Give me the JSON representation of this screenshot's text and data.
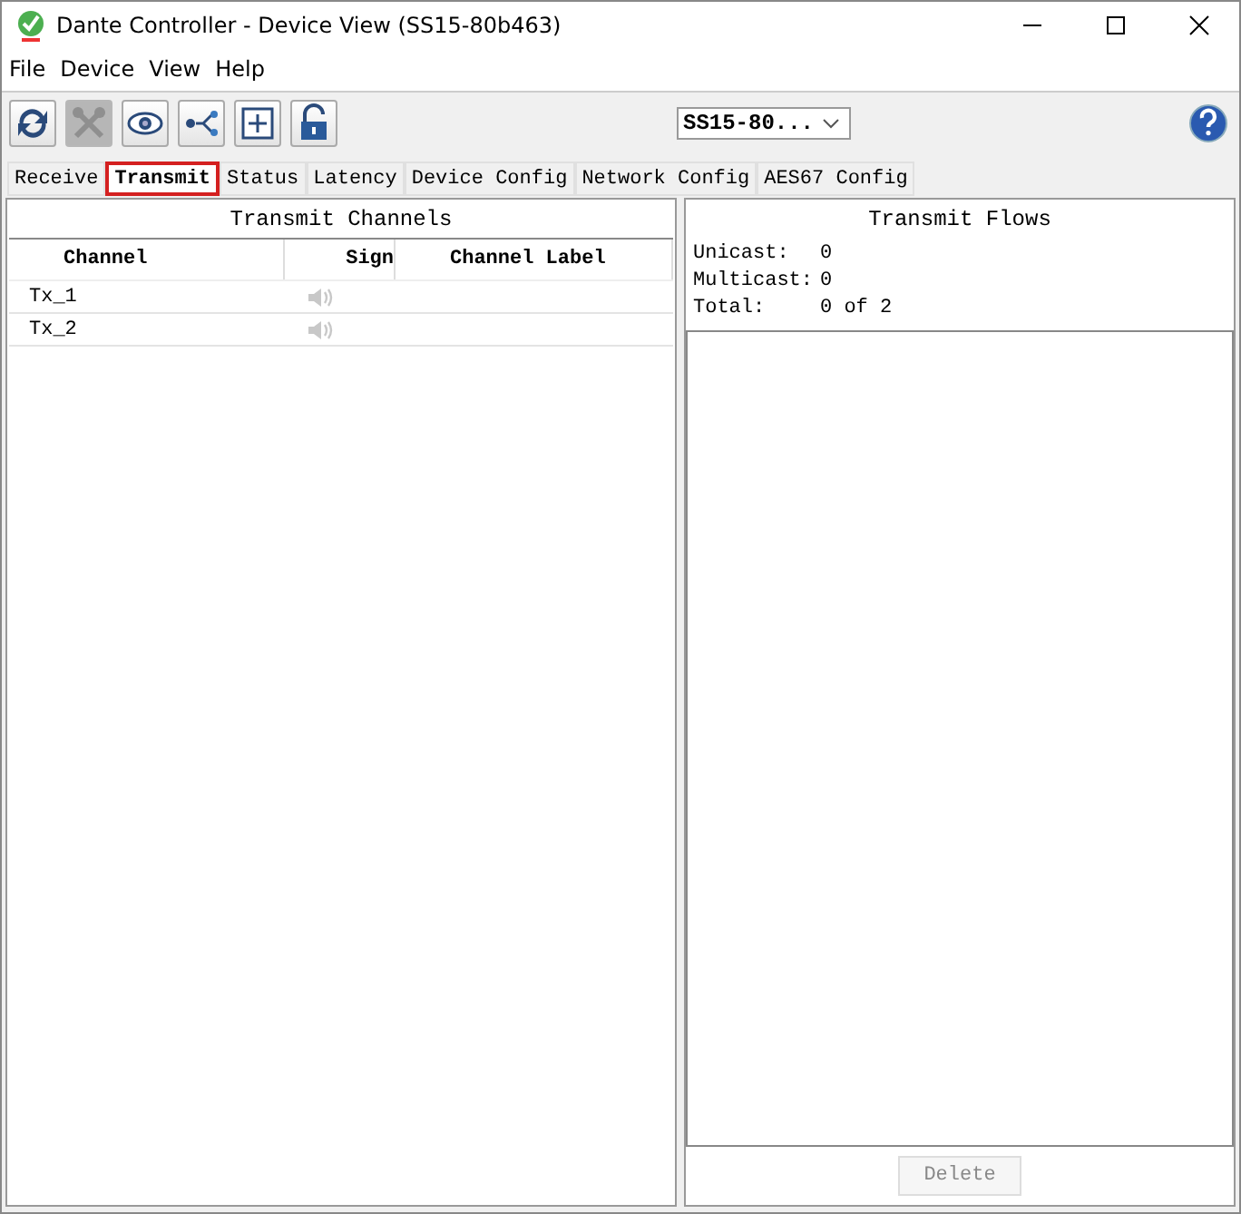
{
  "window": {
    "title": "Dante Controller - Device View (SS15-80b463)"
  },
  "menu": [
    "File",
    "Device",
    "View",
    "Help"
  ],
  "toolbar": [
    {
      "kind": "refresh",
      "disabled": false
    },
    {
      "kind": "tools",
      "disabled": true
    },
    {
      "kind": "eye",
      "disabled": false
    },
    {
      "kind": "network",
      "disabled": false
    },
    {
      "kind": "plus",
      "disabled": false
    },
    {
      "kind": "lock",
      "disabled": false
    }
  ],
  "device_select": {
    "value": "SS15-80..."
  },
  "tabs": [
    {
      "label": "Receive",
      "selected": false
    },
    {
      "label": "Transmit",
      "selected": true
    },
    {
      "label": "Status",
      "selected": false
    },
    {
      "label": "Latency",
      "selected": false
    },
    {
      "label": "Device Config",
      "selected": false
    },
    {
      "label": "Network Config",
      "selected": false
    },
    {
      "label": "AES67 Config",
      "selected": false
    }
  ],
  "transmit_channels": {
    "title": "Transmit Channels",
    "columns": [
      "Channel",
      "Sign",
      "Channel   Label"
    ],
    "rows": [
      {
        "channel": "Tx_1",
        "signal": false
      },
      {
        "channel": "Tx_2",
        "signal": false
      }
    ]
  },
  "transmit_flows": {
    "title": "Transmit Flows",
    "stats": [
      {
        "label": "Unicast:",
        "value": "0"
      },
      {
        "label": "Multicast:",
        "value": "0"
      },
      {
        "label": "Total:",
        "value": "0 of 2"
      }
    ],
    "delete_button": {
      "label": "Delete",
      "disabled": true
    }
  }
}
